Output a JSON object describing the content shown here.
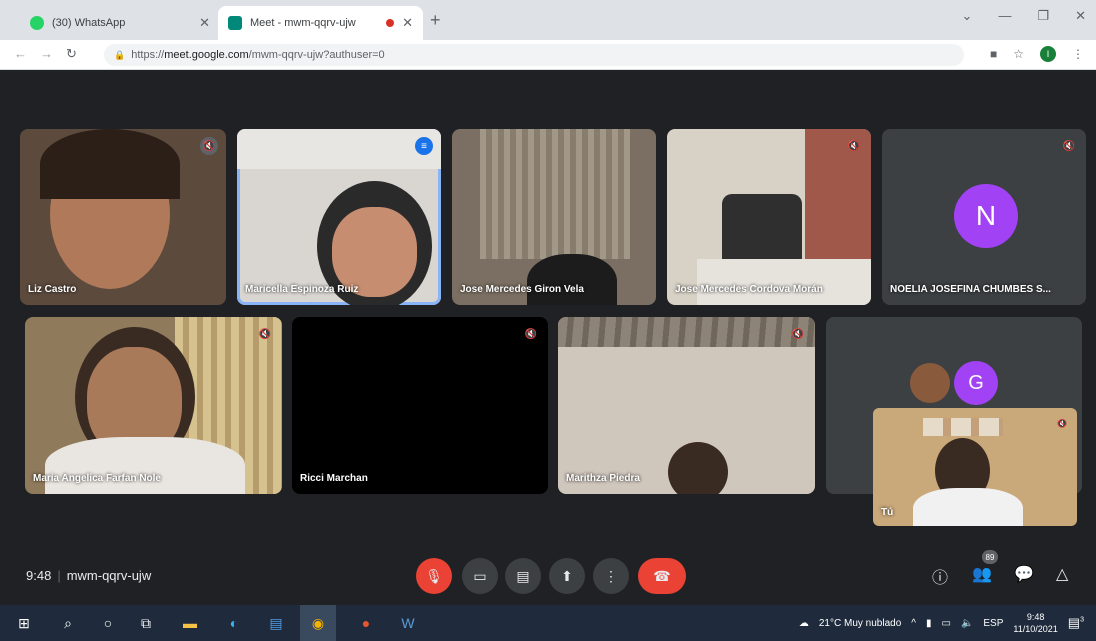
{
  "browser": {
    "tabs": [
      {
        "title": "(30) WhatsApp",
        "fav_color": "#25d366"
      },
      {
        "title": "Meet - mwm-qqrv-ujw",
        "fav_color": "#00897b"
      }
    ],
    "new_tab_symbol": "+",
    "close_symbol": "✕",
    "url_prefix": "https://",
    "url_host": "meet.google.com",
    "url_path": "/mwm-qqrv-ujw?authuser=0",
    "profile_initial": "I"
  },
  "meet": {
    "participants": [
      {
        "name": "Liz Castro",
        "type": "video",
        "bg": "#5c4a3d"
      },
      {
        "name": "Maricella Espinoza Ruiz",
        "type": "video",
        "bg": "#6d6a6a",
        "speaking": true
      },
      {
        "name": "Jose Mercedes Giron Vela",
        "type": "video",
        "bg": "#7a6f62"
      },
      {
        "name": "Jose Mercedes Cordova Morán",
        "type": "video",
        "bg": "#8a7f75"
      },
      {
        "name": "NOELIA JOSEFINA CHUMBES S...",
        "type": "avatar",
        "initial": "N",
        "avatar_color": "#a142f4"
      },
      {
        "name": "Maria Angelica Farfan Nole",
        "type": "video",
        "bg": "#8f7a5c"
      },
      {
        "name": "Ricci Marchan",
        "type": "video",
        "bg": "#000000"
      },
      {
        "name": "Marithza Piedra",
        "type": "video",
        "bg": "#b8ada0"
      },
      {
        "name": "",
        "type": "others",
        "initial": "G",
        "avatar_color": "#a142f4"
      }
    ],
    "self_view": {
      "name": "Tú",
      "bg": "#c9a87a"
    },
    "time": "9:48",
    "meeting_code": "mwm-qqrv-ujw",
    "participant_count": "89"
  },
  "taskbar": {
    "weather": "21°C  Muy nublado",
    "language": "ESP",
    "time": "9:48",
    "date": "11/10/2021",
    "notification_count": "3"
  }
}
